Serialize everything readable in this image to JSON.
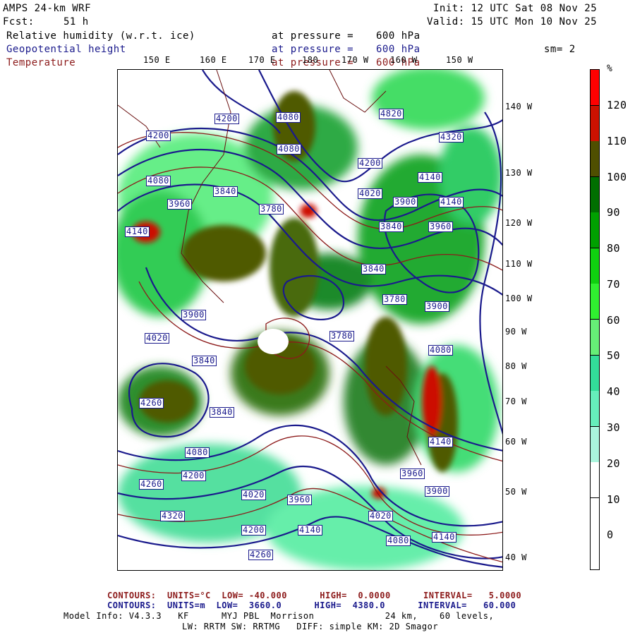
{
  "header": {
    "model": "AMPS 24-km WRF",
    "fcst_label": "Fcst:",
    "fcst_value": "51 h",
    "init": "Init: 12 UTC Sat 08 Nov 25",
    "valid": "Valid: 15 UTC Mon 10 Nov 25",
    "field1": "Relative humidity (w.r.t. ice)",
    "field2": "Geopotential height",
    "field3": "Temperature",
    "pressure_label": "at pressure =",
    "pressure_value": "600 hPa",
    "smoothing": "sm= 2"
  },
  "top_lon_labels": [
    "150 E",
    "160 E",
    "170 E",
    "180",
    "170 W",
    "160 W",
    "150 W"
  ],
  "right_lat_labels": [
    "140 W",
    "130 W",
    "120 W",
    "110 W",
    "100 W",
    "90 W",
    "80 W",
    "70 W",
    "60 W",
    "50 W",
    "40 W"
  ],
  "colorbar": {
    "unit": "%",
    "labels": [
      "120",
      "110",
      "100",
      "90",
      "80",
      "70",
      "60",
      "50",
      "40",
      "30",
      "20",
      "10",
      "0"
    ],
    "colors": [
      "#ff0000",
      "#cc1100",
      "#4f4f00",
      "#006f00",
      "#00a000",
      "#10d010",
      "#30f030",
      "#66ee77",
      "#33dd99",
      "#66eebb",
      "#aaf5dd",
      "#ffffff",
      "#ffffff",
      "#ffffff"
    ]
  },
  "height_labels": [
    "4200",
    "4080",
    "4820",
    "4320",
    "4200",
    "4080",
    "4200",
    "4140",
    "4020",
    "3900",
    "4140",
    "4080",
    "3840",
    "3780",
    "3960",
    "3840",
    "4140",
    "3960",
    "3900",
    "3780",
    "3840",
    "4020",
    "3900",
    "3840",
    "4080",
    "4260",
    "4140",
    "4200",
    "4080",
    "4020",
    "3960",
    "3900",
    "4260",
    "4320",
    "4200",
    "4140",
    "4260",
    "4080",
    "4020",
    "4140",
    "3840",
    "3780",
    "3960"
  ],
  "footer": {
    "temp_contours": "CONTOURS:  UNITS=°C  LOW= -40.000      HIGH=  0.0000      INTERVAL=   5.0000",
    "height_contours": "CONTOURS:  UNITS=m  LOW=  3660.0      HIGH=  4380.0      INTERVAL=   60.000",
    "model_info": "Model Info: V4.3.3   KF      MYJ PBL  Morrison             24 km,    60 levels,",
    "physics": "LW: RRTM SW: RRTMG   DIFF: simple KM: 2D Smagor"
  }
}
